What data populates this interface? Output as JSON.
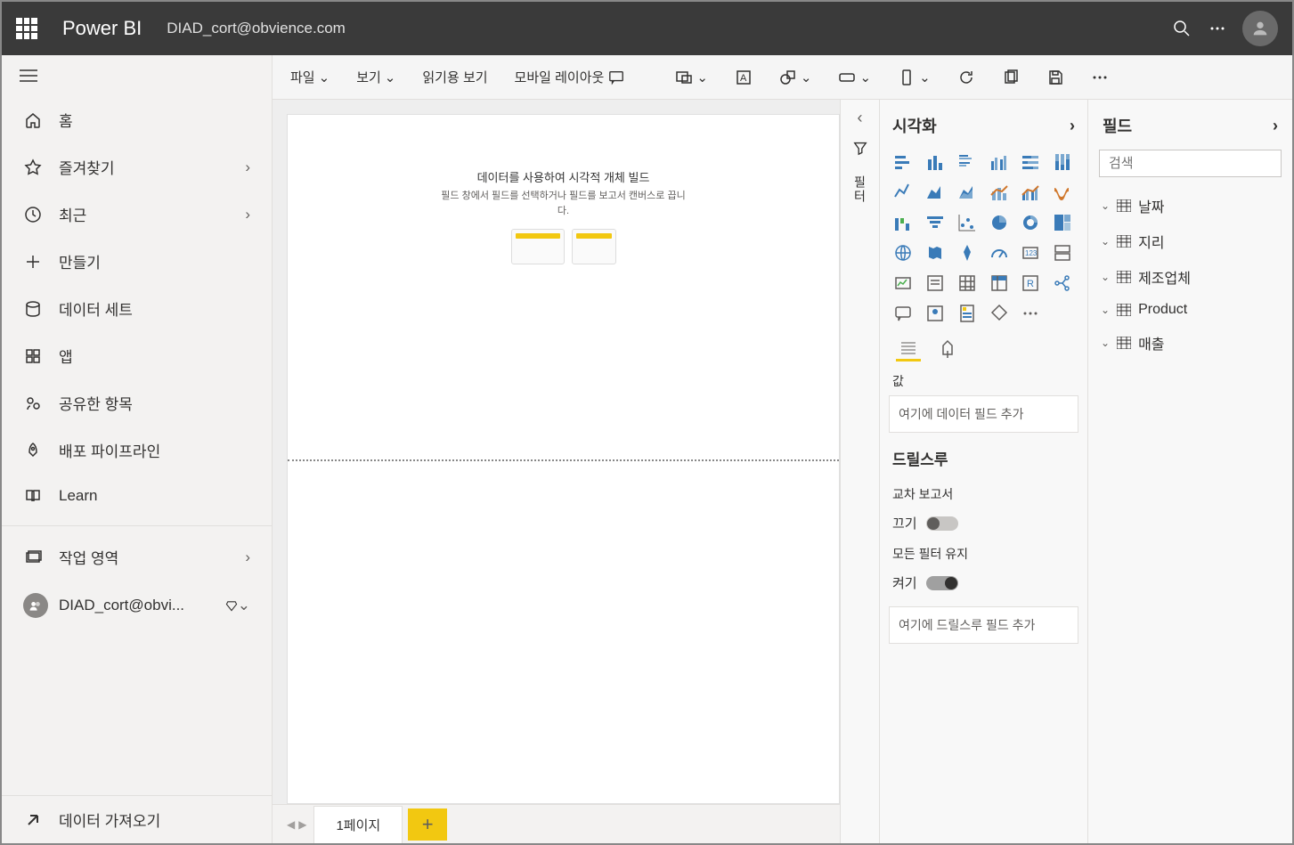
{
  "header": {
    "brand": "Power BI",
    "workspace": "DIAD_cort@obvience.com"
  },
  "nav": {
    "home": "홈",
    "favorites": "즐겨찾기",
    "recent": "최근",
    "create": "만들기",
    "datasets": "데이터 세트",
    "apps": "앱",
    "shared": "공유한 항목",
    "pipelines": "배포 파이프라인",
    "learn": "Learn",
    "workspaces": "작업 영역",
    "current_ws": "DIAD_cort@obvi...",
    "get_data": "데이터 가져오기"
  },
  "toolbar": {
    "file": "파일",
    "view": "보기",
    "reading": "읽기용 보기",
    "mobile": "모바일 레이아웃"
  },
  "canvas": {
    "hint_title": "데이터를 사용하여 시각적 개체 빌드",
    "hint_sub": "필드 창에서 필드를 선택하거나 필드를 보고서 캔버스로 끕니다."
  },
  "page_tab": "1페이지",
  "filters_label": "필터",
  "viz": {
    "title": "시각화",
    "values_label": "값",
    "drop_hint": "여기에 데이터 필드 추가",
    "drillthrough": "드릴스루",
    "cross_report": "교차 보고서",
    "off": "끄기",
    "keep_filters": "모든 필터 유지",
    "on": "켜기",
    "drop_hint2": "여기에 드릴스루 필드 추가"
  },
  "fields": {
    "title": "필드",
    "search_placeholder": "검색",
    "tables": [
      "날짜",
      "지리",
      "제조업체",
      "Product",
      "매출"
    ]
  }
}
